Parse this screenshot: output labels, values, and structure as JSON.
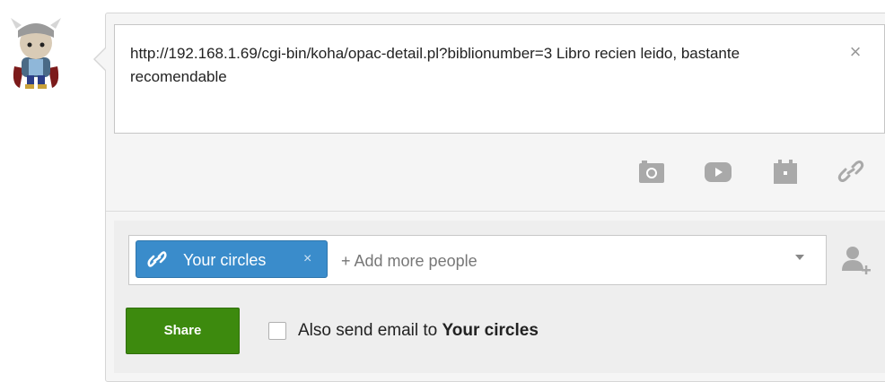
{
  "post": {
    "text": "http://192.168.1.69/cgi-bin/koha/opac-detail.pl?biblionumber=3 Libro recien leido, bastante recomendable"
  },
  "icons": {
    "avatar": "thor-character-avatar",
    "close": "close-icon",
    "photo": "camera-icon",
    "video": "video-icon",
    "event": "calendar-icon",
    "link": "link-icon",
    "add_person": "add-person-icon"
  },
  "audience": {
    "chip_label": "Your circles",
    "chip_remove": "×",
    "add_more_placeholder": "+ Add more people"
  },
  "actions": {
    "share_label": "Share",
    "email_label_prefix": "Also send email to ",
    "email_label_target": "Your circles",
    "email_checked": false,
    "close_symbol": "×"
  },
  "colors": {
    "share_button": "#3d8a0e",
    "chip": "#3a8ccb",
    "panel_bg": "#f5f5f5",
    "audience_bg": "#eeeeee"
  }
}
